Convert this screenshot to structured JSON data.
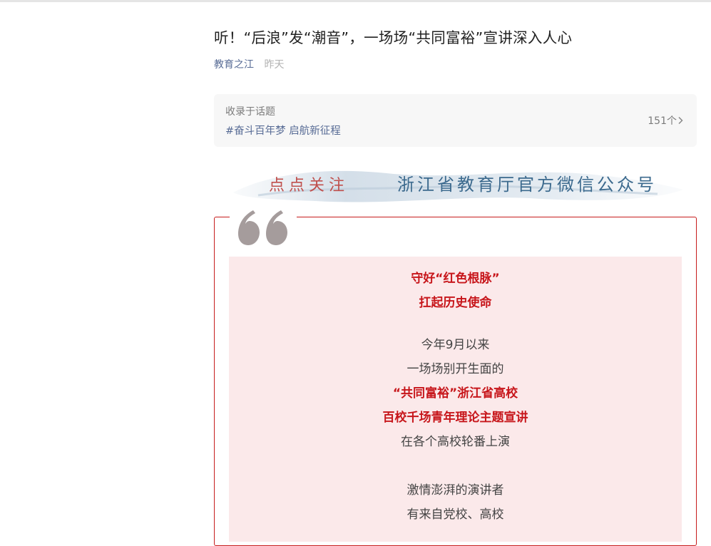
{
  "article": {
    "title": "听！“后浪”发“潮音”，一场场“共同富裕”宣讲深入人心",
    "author": "教育之江",
    "time": "昨天"
  },
  "topic": {
    "label": "收录于话题",
    "tag": "#奋斗百年梦 启航新征程",
    "count": "151个"
  },
  "banner": {
    "left_text": "点点关注",
    "right_text": "浙江省教育厅官方微信公众号"
  },
  "content": {
    "lines": [
      "守好“红色根脉”",
      "扛起历史使命",
      "今年9月以来",
      "一场场别开生面的",
      "“共同富裕”浙江省高校",
      "百校千场青年理论主题宣讲",
      "在各个高校轮番上演",
      "激情澎湃的演讲者",
      "有来自党校、高校"
    ]
  },
  "colors": {
    "accent_red": "#c7161b",
    "link_blue": "#576b95",
    "pink_bg": "#fbe9ea"
  },
  "icons": {
    "quote": "quote-mark-icon",
    "chevron": "chevron-right-icon"
  }
}
